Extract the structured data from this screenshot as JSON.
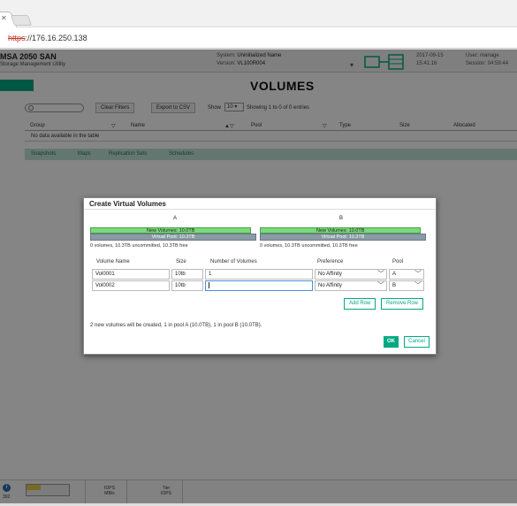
{
  "browser": {
    "close_glyph": "✕",
    "url_scheme": "https",
    "url_rest": "://176.16.250.138"
  },
  "header": {
    "product": "MSA 2050 SAN",
    "subtitle": "Storage Management Utility",
    "system_label": "System:",
    "system_value": "Uninitialized Name",
    "version_label": "Version:",
    "version_value": "VL100R004",
    "date": "2017-09-15",
    "time": "15:41:16",
    "user_label": "User:",
    "user_value": "manage",
    "session_label": "Session:",
    "session_value": "04:59:44"
  },
  "page": {
    "title": "VOLUMES"
  },
  "toolbar": {
    "search_placeholder": "",
    "clear_filters": "Clear Filters",
    "export_csv": "Export to CSV",
    "show_label": "Show",
    "show_value": "10",
    "showing_text": "Showing 1 to 0 of 0 entries"
  },
  "table": {
    "headers": [
      "Group",
      "Name",
      "Pool",
      "Type",
      "Size",
      "Allocated"
    ],
    "empty_text": "No data available in the table"
  },
  "subtabs": [
    "Snapshots",
    "Maps",
    "Replication Sets",
    "Schedules"
  ],
  "statusbar": {
    "count": "392",
    "iops_label": "IOPS",
    "mbs_label": "MB/s",
    "tier_label": "Tier",
    "tier_sub": "IOPS"
  },
  "dialog": {
    "title": "Create Virtual Volumes",
    "pools": [
      {
        "label": "A",
        "new_volumes": "New Volumes: 10.0TB",
        "virtual_pool": "Virtual Pool: 10.3TB",
        "summary": "0 volumes, 10.3TB uncommitted, 10.3TB free",
        "new_fraction": 0.97
      },
      {
        "label": "B",
        "new_volumes": "New Volumes: 10.0TB",
        "virtual_pool": "Virtual Pool: 10.3TB",
        "summary": "0 volumes, 10.3TB uncommitted, 10.3TB free",
        "new_fraction": 0.97
      }
    ],
    "columns": {
      "volume_name": "Volume Name",
      "size": "Size",
      "number": "Number of Volumes",
      "preference": "Preference",
      "pool": "Pool"
    },
    "rows": [
      {
        "name": "Vol0001",
        "size": "10tb",
        "count": "1",
        "preference": "No Affinity",
        "pool": "A"
      },
      {
        "name": "Vol0002",
        "size": "10tb",
        "count": "",
        "preference": "No Affinity",
        "pool": "B"
      }
    ],
    "add_row": "Add Row",
    "remove_row": "Remove Row",
    "info": "2 new volumes will be created, 1 in pool A (10.0TB), 1 in pool B (10.0TB).",
    "ok": "OK",
    "cancel": "Cancel"
  },
  "colors": {
    "accent": "#01a982",
    "new_volumes": "#7bd97b",
    "virtual_pool": "#8a9aa6"
  }
}
